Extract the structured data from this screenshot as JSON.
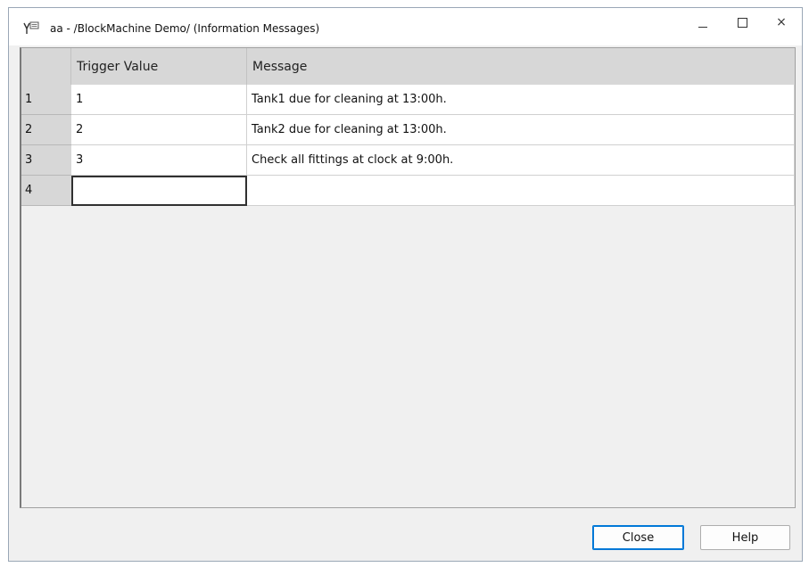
{
  "window": {
    "title": "aa - /BlockMachine Demo/ (Information Messages)",
    "min_label": "–",
    "close_label": "×"
  },
  "table": {
    "columns": [
      "Trigger Value",
      "Message"
    ],
    "rows": [
      {
        "num": "1",
        "trigger": "1",
        "message": "Tank1 due for cleaning at 13:00h."
      },
      {
        "num": "2",
        "trigger": "2",
        "message": "Tank2 due for cleaning at 13:00h."
      },
      {
        "num": "3",
        "trigger": "3",
        "message": "Check all fittings at clock at 9:00h."
      },
      {
        "num": "4",
        "trigger": "",
        "message": ""
      }
    ]
  },
  "buttons": {
    "close": "Close",
    "help": "Help"
  },
  "colors": {
    "accent": "#0078d7",
    "header_bg": "#d7d7d7",
    "window_bg": "#f0f0f0"
  },
  "icons": {
    "app": "grid-message-icon",
    "minimize": "minimize-icon",
    "maximize": "maximize-icon",
    "close": "close-icon"
  }
}
